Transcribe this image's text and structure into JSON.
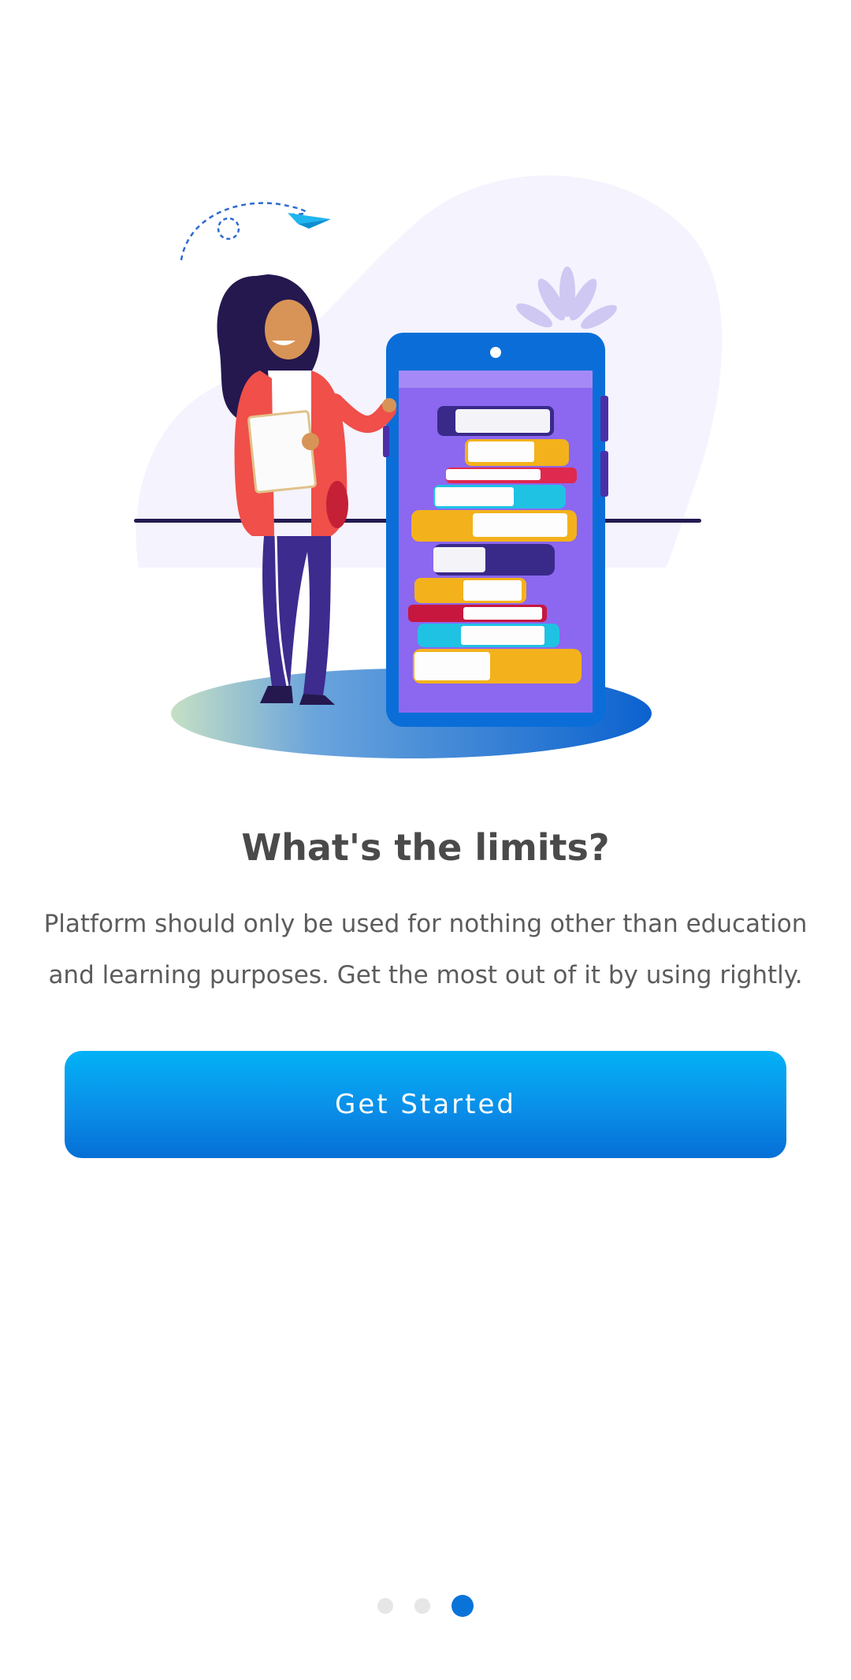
{
  "onboarding": {
    "title": "What's the limits?",
    "description": "Platform should only be used for nothing other than education and learning purposes. Get the most out of it by using rightly.",
    "cta_label": "Get Started",
    "illustration_icon": "woman-with-phone-books-illustration"
  },
  "pagination": {
    "current_page": 3,
    "total_pages": 3
  },
  "colors": {
    "accent": "#0a73d9",
    "button_top": "#03b2f6",
    "button_bottom": "#056fd6",
    "title_text": "#4a4a4a",
    "body_text": "#5c5c5c",
    "inactive_dot": "#e6e6e6"
  }
}
